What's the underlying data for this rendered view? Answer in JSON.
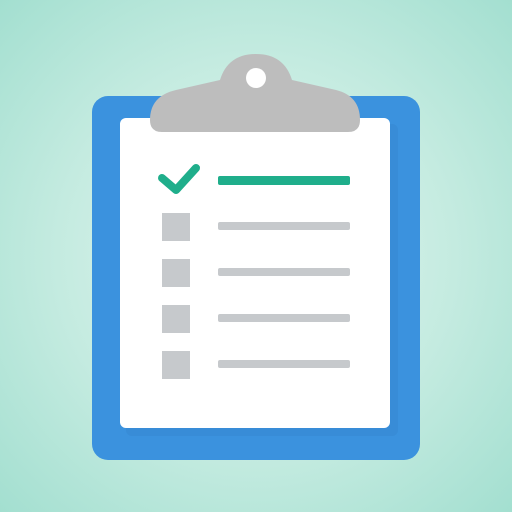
{
  "icon": {
    "name": "clipboard-checklist-icon",
    "colors": {
      "background_center": "#e6f6f1",
      "background_edge": "#a3dfd0",
      "clipboard": "#3b92de",
      "clipboard_shadow": "#2f7cc4",
      "paper": "#ffffff",
      "clip": "#bdbdbd",
      "check": "#1fae8b",
      "done_line": "#1fae8b",
      "box": "#c6c9cc",
      "line": "#c6c9cc"
    },
    "items": [
      {
        "checked": true
      },
      {
        "checked": false
      },
      {
        "checked": false
      },
      {
        "checked": false
      },
      {
        "checked": false
      }
    ]
  }
}
